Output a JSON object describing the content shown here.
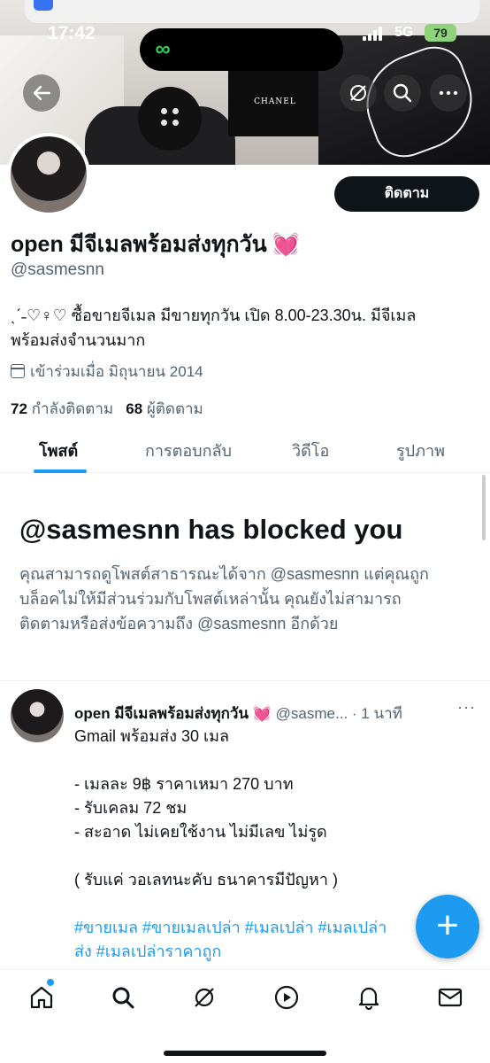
{
  "status_bar": {
    "time": "17:42",
    "network": "5G",
    "battery": "79"
  },
  "profile": {
    "follow_label": "ติดตาม",
    "display_name": "open มีจีเมลพร้อมส่งทุกวัน",
    "name_emoji": "💓",
    "handle": "@sasmesnn",
    "bio_line1": "ˎˊ˗♡♀♡ ซื้อขายจีเมล มีขายทุกวัน เปิด 8.00-23.30น. มีจีเมล",
    "bio_line2": "พร้อมส่งจำนวนมาก",
    "joined": "เข้าร่วมเมื่อ มิถุนายน 2014",
    "following_count": "72",
    "following_label": "กำลังติดตาม",
    "followers_count": "68",
    "followers_label": "ผู้ติดตาม"
  },
  "banner": {
    "bag_label": "CHANEL"
  },
  "tabs": [
    "โพสต์",
    "การตอบกลับ",
    "วิดีโอ",
    "รูปภาพ"
  ],
  "blocked": {
    "title": "@sasmesnn has blocked you",
    "line1": "คุณสามารถดูโพสต์สาธารณะได้จาก @sasmesnn แต่คุณถูก",
    "line2": "บล็อคไม่ให้มีส่วนร่วมกับโพสต์เหล่านั้น คุณยังไม่สามารถ",
    "line3": "ติดตามหรือส่งข้อความถึง @sasmesnn อีกด้วย"
  },
  "tweet": {
    "name": "open มีจีเมลพร้อมส่งทุกวัน",
    "emoji": "💓",
    "handle_time": "@sasme... · 1 นาที",
    "more": "···",
    "lines": [
      "Gmail พร้อมส่ง  30 เมล",
      "",
      "- เมลละ 9฿ ราคาเหมา  270 บาท",
      "- รับเคลม 72 ชม",
      "- สะอาด ไม่เคยใช้งาน ไม่มีเลข ไม่รูด",
      "",
      "( รับแค่ วอเลทนะคับ ธนาคารมีปัญหา )"
    ],
    "tags_line1": "#ขายเมล #ขายเมลเปล่า #เมลเปล่า #เมลเปล่า",
    "tags_line2": "ส่ง #เมลเปล่าราคาถูก"
  },
  "fab_label": "+",
  "nav_icons": [
    "home-icon",
    "search-icon",
    "grok-icon",
    "video-icon",
    "notifications-icon",
    "messages-icon"
  ],
  "colors": {
    "accent": "#1d9bf0",
    "text": "#0f1419",
    "muted": "#536471",
    "heart": "#e8459a"
  }
}
